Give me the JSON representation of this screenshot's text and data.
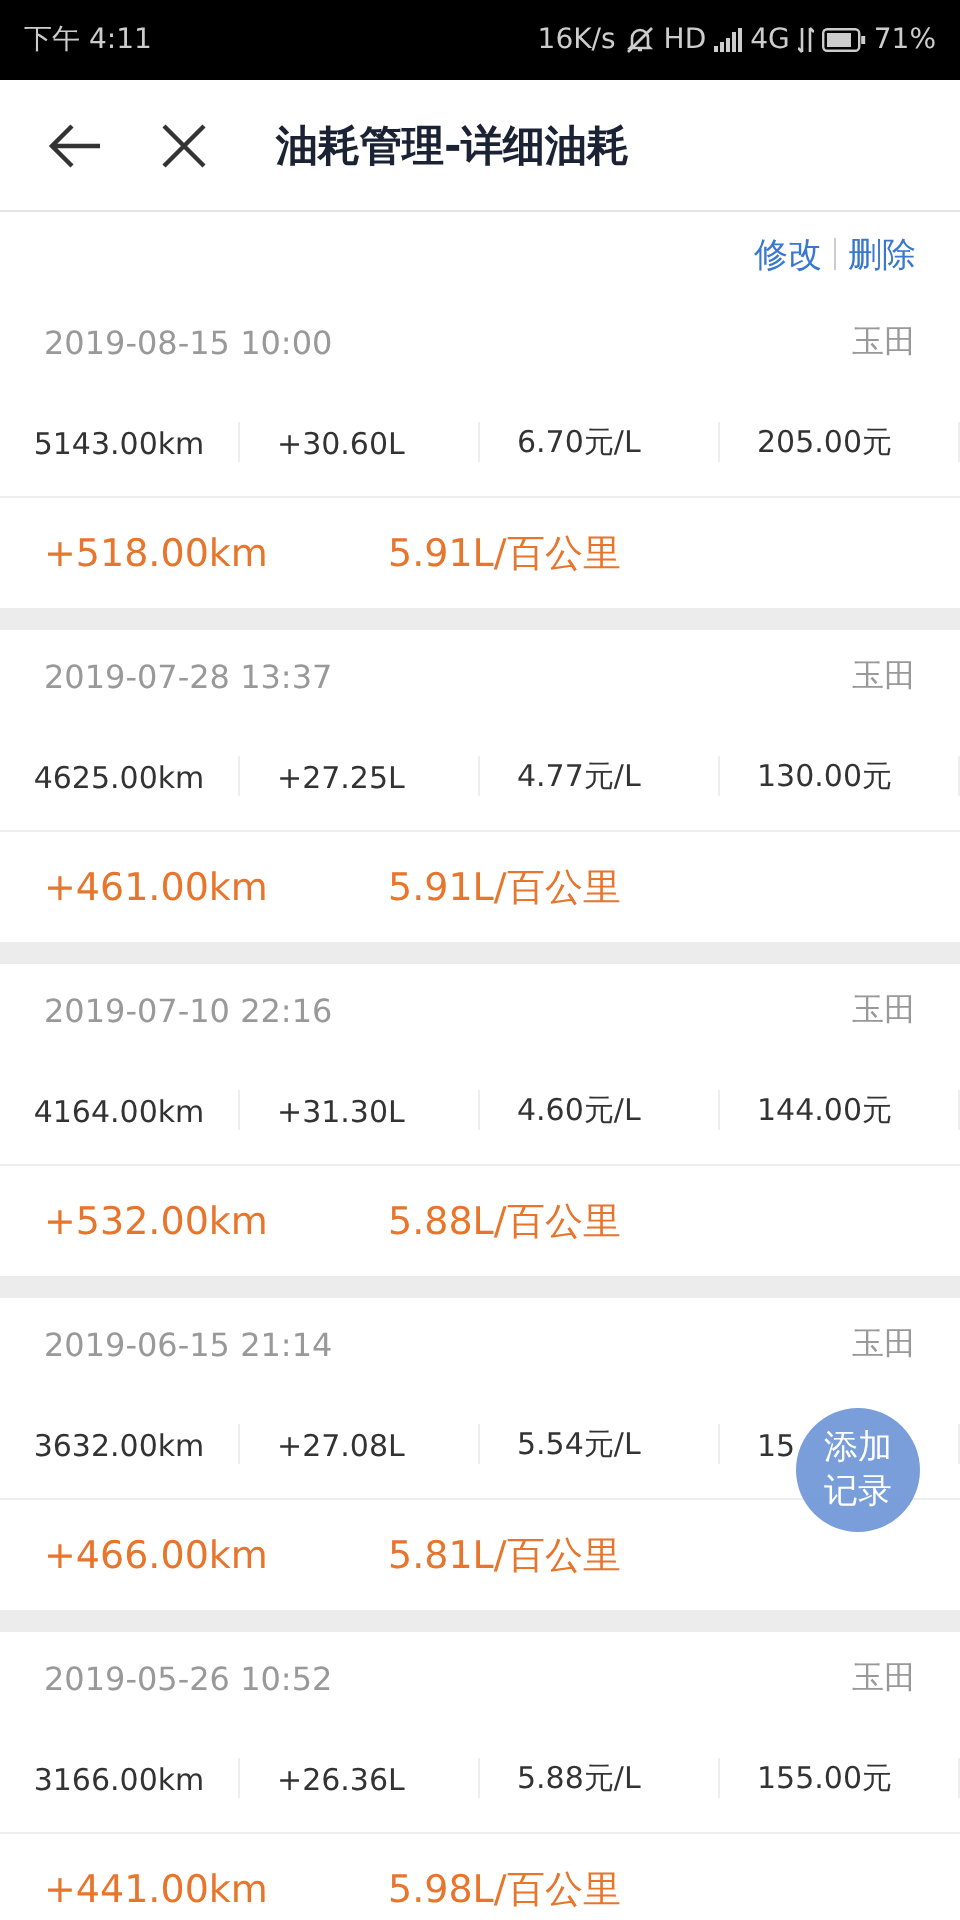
{
  "status_bar": {
    "time": "下午 4:11",
    "speed": "16K/s",
    "hd": "HD",
    "network": "4G",
    "battery": "71%"
  },
  "header": {
    "title": "油耗管理-详细油耗"
  },
  "actions": [
    "修改",
    "删除"
  ],
  "records": [
    {
      "datetime": "2019-08-15 10:00",
      "place": "玉田",
      "values": [
        "5143.00km",
        "+30.60L",
        "6.70元/L",
        "205.00元"
      ],
      "distance": "+518.00km",
      "consumption": "5.91L/百公里"
    },
    {
      "datetime": "2019-07-28 13:37",
      "place": "玉田",
      "values": [
        "4625.00km",
        "+27.25L",
        "4.77元/L",
        "130.00元"
      ],
      "distance": "+461.00km",
      "consumption": "5.91L/百公里"
    },
    {
      "datetime": "2019-07-10 22:16",
      "place": "玉田",
      "values": [
        "4164.00km",
        "+31.30L",
        "4.60元/L",
        "144.00元"
      ],
      "distance": "+532.00km",
      "consumption": "5.88L/百公里"
    },
    {
      "datetime": "2019-06-15 21:14",
      "place": "玉田",
      "values": [
        "3632.00km",
        "+27.08L",
        "5.54元/L",
        "15"
      ],
      "distance": "+466.00km",
      "consumption": "5.81L/百公里"
    },
    {
      "datetime": "2019-05-26 10:52",
      "place": "玉田",
      "values": [
        "3166.00km",
        "+26.36L",
        "5.88元/L",
        "155.00元"
      ],
      "distance": "+441.00km",
      "consumption": "5.98L/百公里"
    }
  ],
  "fab": {
    "label": "添加记录"
  }
}
